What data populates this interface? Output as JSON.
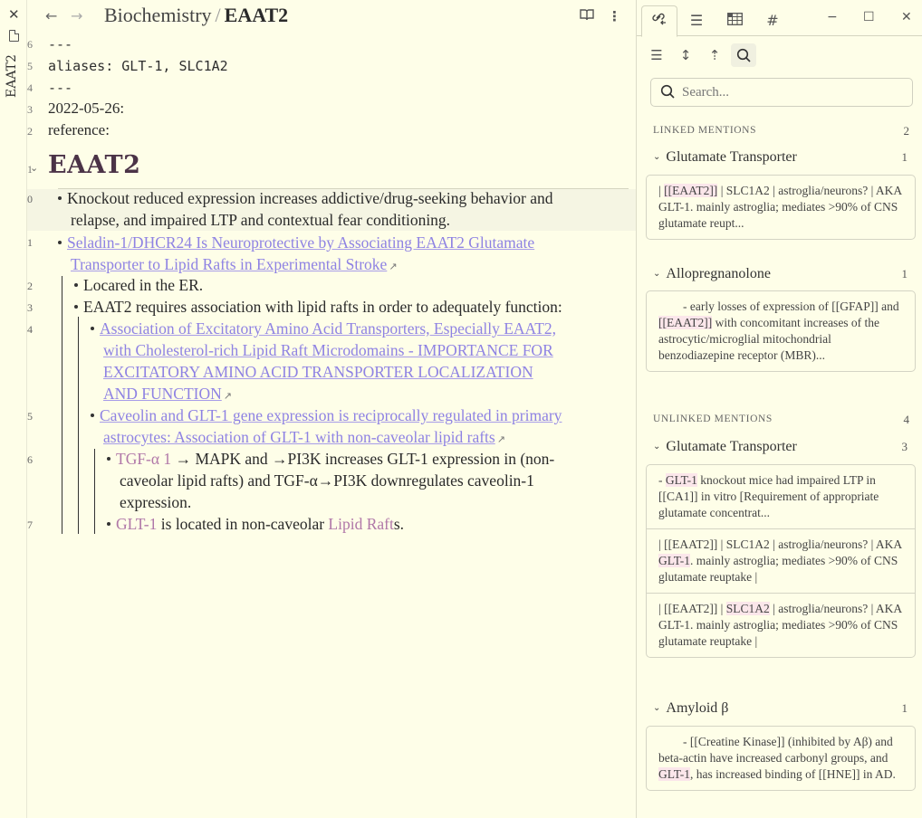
{
  "sidebar_strip": {
    "close_icon": "✕",
    "file_icon": "file-icon",
    "note_title": "EAAT2"
  },
  "header": {
    "back_icon": "←",
    "forward_icon": "→",
    "breadcrumb_parent": "Biochemistry",
    "breadcrumb_sep": "/",
    "title": "EAAT2",
    "reading_view_icon": "⊡",
    "more_icon": "⋮"
  },
  "frontmatter": [
    {
      "line": "6",
      "text": "---"
    },
    {
      "line": "5",
      "text": "aliases: GLT-1, SLC1A2"
    },
    {
      "line": "4",
      "text": "---"
    }
  ],
  "properties": [
    {
      "line": "3",
      "text": "2022-05-26:"
    },
    {
      "line": "2",
      "text": "reference:"
    }
  ],
  "heading": {
    "line": "1",
    "text": "EAAT2",
    "fold_icon": "⌄"
  },
  "items": [
    {
      "line": "0",
      "text_l1": "Knockout reduced expression increases addictive/drug-seeking behavior and",
      "text_l2": "relapse, and impaired LTP and contextual fear conditioning."
    },
    {
      "line": "1",
      "link_l1": "Seladin-1/DHCR24 Is Neuroprotective by Associating EAAT2 Glutamate",
      "link_l2": "Transporter to Lipid Rafts in Experimental Stroke",
      "ext_icon": "↗"
    },
    {
      "line": "2",
      "text": "Locared in the ER."
    },
    {
      "line": "3",
      "text": "EAAT2 requires association with lipid rafts in order to adequately function:"
    },
    {
      "line": "4",
      "link_l1": "Association of Excitatory Amino Acid Transporters, Especially EAAT2,",
      "link_l2": "with Cholesterol-rich Lipid Raft Microdomains - IMPORTANCE FOR",
      "link_l3": "EXCITATORY AMINO ACID TRANSPORTER LOCALIZATION",
      "link_l4": "AND FUNCTION",
      "ext_icon": "↗"
    },
    {
      "line": "5",
      "link_l1": "Caveolin and GLT-1 gene expression is reciprocally regulated in primary",
      "link_l2": "astrocytes: Association of GLT-1 with non-caveolar lipid rafts",
      "ext_icon": "↗"
    },
    {
      "line": "6",
      "internal": "TGF-α 1",
      "text_l1": " → MAPK and →PI3K increases GLT-1 expression in (non-",
      "text_l2": "caveolar lipid rafts) and TGF-α→PI3K downregulates caveolin-1",
      "text_l3": "expression."
    },
    {
      "line": "7",
      "internal": "GLT-1",
      "text_mid": " is located in non-caveolar ",
      "internal2": "Lipid Raft",
      "text_end": "s."
    }
  ],
  "panel": {
    "tabs": [
      {
        "name": "backlinks",
        "icon": "🔗︎"
      },
      {
        "name": "outline",
        "icon": "☰"
      },
      {
        "name": "table",
        "icon": "▦"
      },
      {
        "name": "tags",
        "icon": "#"
      }
    ],
    "window": {
      "minimize": "−",
      "maximize": "☐",
      "close": "✕"
    },
    "toolbar": [
      {
        "name": "collapse-results",
        "icon": "☰"
      },
      {
        "name": "show-more-context",
        "icon": "↕"
      },
      {
        "name": "sort",
        "icon": "⇡"
      },
      {
        "name": "show-search",
        "icon": "⌕"
      }
    ],
    "search": {
      "placeholder": "Search...",
      "value": ""
    },
    "linked": {
      "title": "LINKED MENTIONS",
      "count": "2",
      "groups": [
        {
          "title": "Glutamate Transporter",
          "count": "1",
          "snippets": [
            {
              "pre": "| ",
              "hl": "[[EAAT2]]",
              "post": "  | SLC1A2  | astroglia/neurons? | AKA GLT-1. mainly astroglia; mediates >90% of CNS glutamate reupt..."
            }
          ]
        },
        {
          "title": "Allopregnanolone",
          "count": "1",
          "snippets": [
            {
              "pre": "        - early losses of expression of [[GFAP]] and ",
              "hl": "[[EAAT2]]",
              "post": " with concomitant increases of the astrocytic/microglial mitochondrial benzodiazepine receptor (MBR)..."
            }
          ]
        }
      ]
    },
    "unlinked": {
      "title": "UNLINKED MENTIONS",
      "count": "4",
      "groups": [
        {
          "title": "Glutamate Transporter",
          "count": "3",
          "snippets": [
            {
              "pre": "- ",
              "hl": "GLT-1",
              "post": " knockout mice had impaired LTP in [[CA1]] in vitro [Requirement of appropriate glutamate concentrat..."
            },
            {
              "pre": "| [[EAAT2]]  | SLC1A2  | astroglia/neurons? | AKA ",
              "hl": "GLT-1",
              "post": ". mainly astroglia; mediates >90% of CNS glutamate reuptake |"
            },
            {
              "pre": "| [[EAAT2]]  | ",
              "hl": "SLC1A2",
              "post": "  | astroglia/neurons? | AKA GLT-1. mainly astroglia; mediates >90% of CNS glutamate reuptake |"
            }
          ]
        },
        {
          "title": "Amyloid β",
          "count": "1",
          "snippets": [
            {
              "pre": "        - [[Creatine Kinase]] (inhibited by Aβ) and beta-actin have increased carbonyl groups, and ",
              "hl": "GLT-1",
              "post": ", has increased binding of [[HNE]] in AD."
            }
          ]
        }
      ]
    }
  }
}
